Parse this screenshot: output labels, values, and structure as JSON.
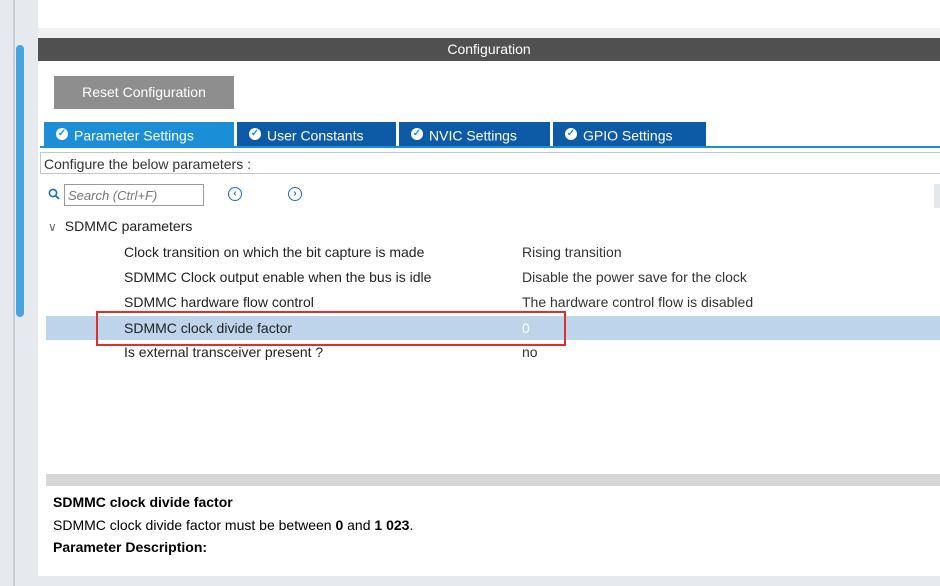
{
  "config_title": "Configuration",
  "reset_button": "Reset Configuration",
  "tabs": [
    {
      "label": "Parameter Settings",
      "icon": "check-circle-icon"
    },
    {
      "label": "User Constants",
      "icon": "check-circle-icon"
    },
    {
      "label": "NVIC Settings",
      "icon": "check-circle-icon"
    },
    {
      "label": "GPIO Settings",
      "icon": "check-circle-icon"
    }
  ],
  "configure_label": "Configure the below parameters :",
  "search": {
    "placeholder": "Search (Ctrl+F)"
  },
  "group_label": "SDMMC parameters",
  "params": [
    {
      "name": "Clock transition on which the bit capture is made",
      "value": "Rising transition"
    },
    {
      "name": "SDMMC Clock output enable when the bus is idle",
      "value": "Disable the power save for the clock"
    },
    {
      "name": "SDMMC hardware flow control",
      "value": "The hardware control flow is disabled"
    },
    {
      "name": "SDMMC clock divide factor",
      "value": "0"
    },
    {
      "name": "Is external transceiver present ?",
      "value": "no"
    }
  ],
  "description": {
    "title": "SDMMC clock divide factor",
    "text_prefix": "SDMMC clock divide factor must be between ",
    "min": "0",
    "and": " and ",
    "max": "1 023",
    "suffix": ".",
    "section": "Parameter Description:"
  },
  "colors": {
    "header": "#505050",
    "tab_active": "#1a8fd8",
    "tab": "#0d5aa7",
    "highlight": "#e0302c",
    "selected_row": "#bdd4ea"
  }
}
